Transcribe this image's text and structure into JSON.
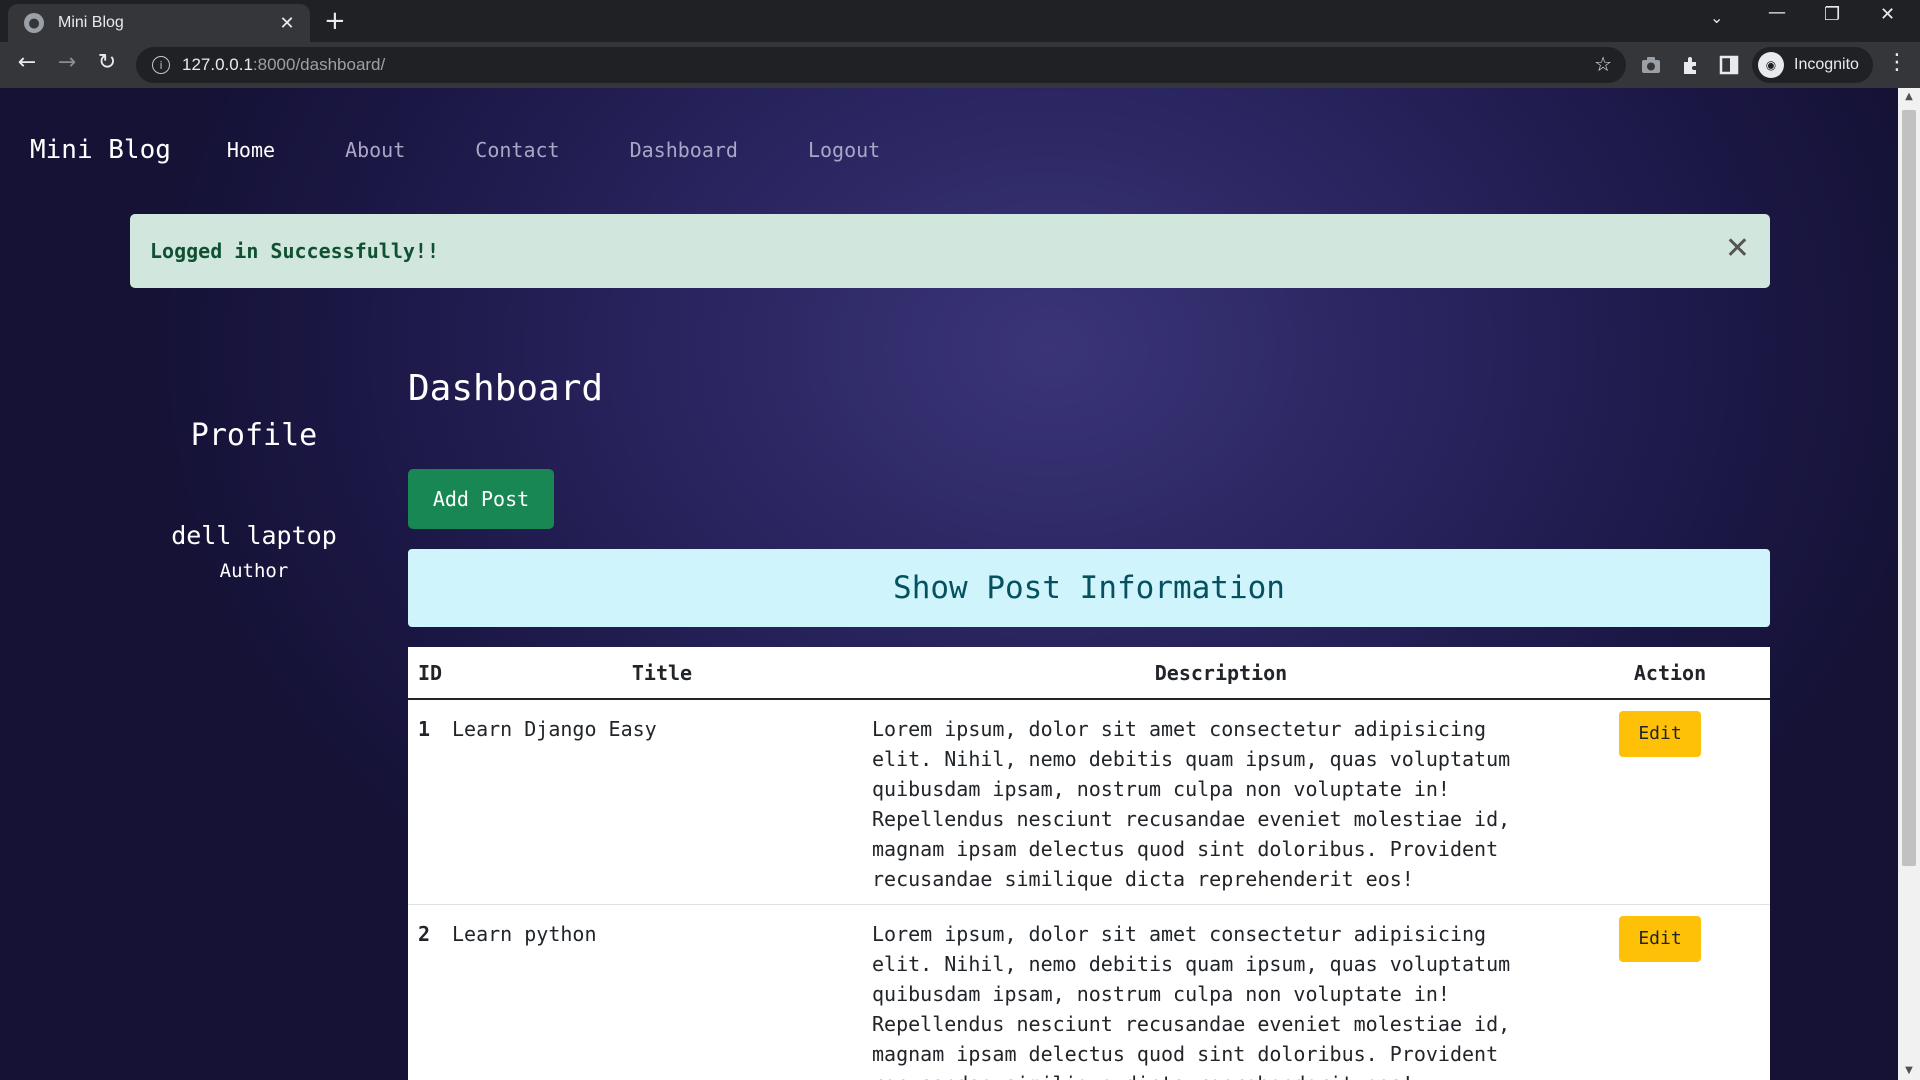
{
  "browser": {
    "tab_title": "Mini Blog",
    "url_host": "127.0.0.1",
    "url_path": ":8000/dashboard/",
    "profile_label": "Incognito"
  },
  "nav": {
    "brand": "Mini Blog",
    "links": [
      "Home",
      "About",
      "Contact",
      "Dashboard",
      "Logout"
    ],
    "active": "Home"
  },
  "alert": {
    "message": "Logged in Successfully!!"
  },
  "profile": {
    "heading": "Profile",
    "name": "dell laptop",
    "role": "Author"
  },
  "dashboard": {
    "title": "Dashboard",
    "add_post_label": "Add Post",
    "info_heading": "Show Post Information",
    "columns": [
      "ID",
      "Title",
      "Description",
      "Action"
    ],
    "posts": [
      {
        "id": "1",
        "title": "Learn Django Easy",
        "description": "Lorem ipsum, dolor sit amet consectetur adipisicing elit. Nihil, nemo debitis quam ipsum, quas voluptatum quibusdam ipsam, nostrum culpa non voluptate in! Repellendus nesciunt recusandae eveniet molestiae id, magnam ipsam delectus quod sint doloribus. Provident recusandae similique dicta reprehenderit eos!",
        "action": "Edit"
      },
      {
        "id": "2",
        "title": "Learn python",
        "description": "Lorem ipsum, dolor sit amet consectetur adipisicing elit. Nihil, nemo debitis quam ipsum, quas voluptatum quibusdam ipsam, nostrum culpa non voluptate in! Repellendus nesciunt recusandae eveniet molestiae id, magnam ipsam delectus quod sint doloribus. Provident recusandae similique dicta reprehenderit eos!",
        "action": "Edit"
      }
    ]
  },
  "colors": {
    "success_alert_bg": "#d1e7dd",
    "add_button": "#198754",
    "info_bar_bg": "#cff4fc",
    "edit_button": "#ffc107"
  }
}
